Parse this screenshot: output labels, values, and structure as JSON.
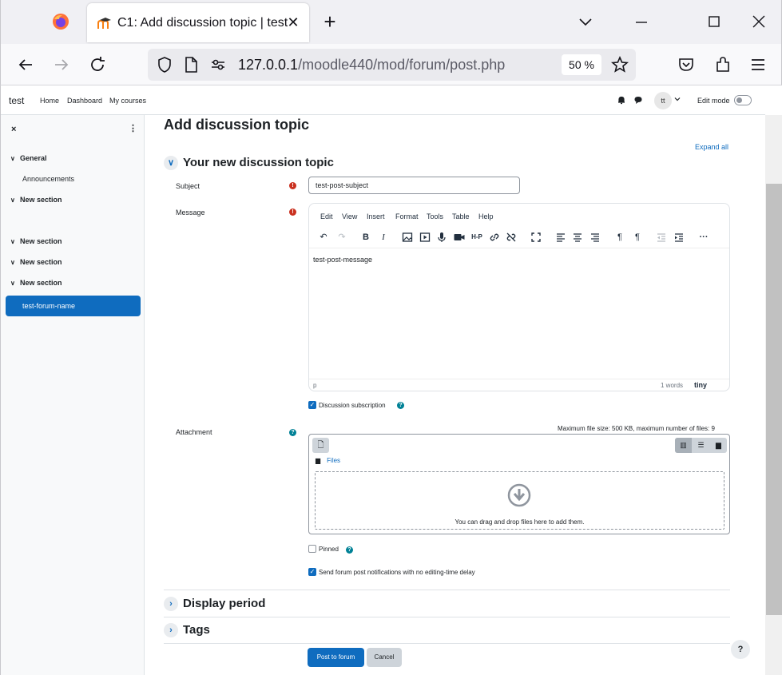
{
  "browser": {
    "tab_title": "C1: Add discussion topic | test",
    "tab_close": "✕",
    "new_tab": "+",
    "url_host": "127.0.0.1",
    "url_path": "/moodle440/mod/forum/post.php",
    "zoom": "50 %"
  },
  "topnav": {
    "brand": "test",
    "links": [
      "Home",
      "Dashboard",
      "My courses"
    ],
    "avatar": "tt",
    "edit_mode": "Edit mode"
  },
  "drawer": {
    "close": "×",
    "menu": "⋮",
    "items": [
      {
        "label": "General",
        "type": "section"
      },
      {
        "label": "Announcements",
        "type": "activity"
      },
      {
        "label": "New section",
        "type": "section"
      },
      {
        "label": "test-forum-name",
        "type": "activity-active"
      },
      {
        "label": "New section",
        "type": "section"
      },
      {
        "label": "New section",
        "type": "section"
      },
      {
        "label": "New section",
        "type": "section"
      }
    ]
  },
  "main": {
    "heading": "Add discussion topic",
    "expand_all": "Expand all",
    "section_new_topic": "Your new discussion topic",
    "subject_label": "Subject",
    "subject_value": "test-post-subject",
    "message_label": "Message",
    "editor": {
      "menus": [
        "Edit",
        "View",
        "Insert",
        "Format",
        "Tools",
        "Table",
        "Help"
      ],
      "content": "test-post-message",
      "path": "p",
      "words": "1 words",
      "brand": "tiny"
    },
    "discussion_subscription": "Discussion subscription",
    "attachment_label": "Attachment",
    "max_size": "Maximum file size: 500 KB, maximum number of files: 9",
    "files_path": "Files",
    "dropzone_text": "You can drag and drop files here to add them.",
    "pinned": "Pinned",
    "notify_no_delay": "Send forum post notifications with no editing-time delay",
    "section_display_period": "Display period",
    "section_tags": "Tags",
    "post_button": "Post to forum",
    "cancel_button": "Cancel",
    "help_button": "?"
  },
  "colors": {
    "accent": "#0f6cbf",
    "required": "#ca3120",
    "help": "#008196"
  }
}
